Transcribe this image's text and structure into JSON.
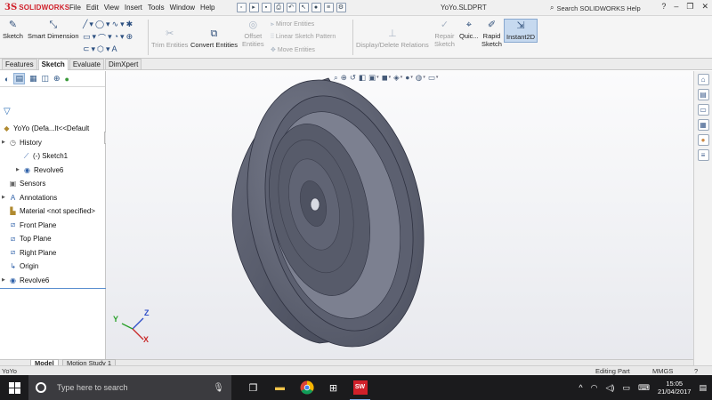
{
  "app": {
    "brand_prefix": "3S",
    "brand": "SOLIDWORKS",
    "menu": [
      "File",
      "Edit",
      "View",
      "Insert",
      "Tools",
      "Window",
      "Help"
    ],
    "document_title": "YoYo.SLDPRT",
    "search_placeholder": "Search SOLIDWORKS Help",
    "window_buttons": [
      "?",
      "–",
      "❐",
      "✕"
    ]
  },
  "command_manager": {
    "sketch": "Sketch",
    "smart_dimension": "Smart Dimension",
    "trim_entities_1": "Trim",
    "trim_entities_2": "Entities",
    "convert_entities_1": "Convert",
    "convert_entities_2": "Entities",
    "offset_entities_1": "Offset",
    "offset_entities_2": "Entities",
    "mirror_entities": "Mirror Entities",
    "linear_sketch_pattern": "Linear Sketch Pattern",
    "move_entities": "Move Entities",
    "display_delete_relations": "Display/Delete Relations",
    "repair_sketch_1": "Repair",
    "repair_sketch_2": "Sketch",
    "quick_snaps": "Quic...",
    "rapid_sketch_1": "Rapid",
    "rapid_sketch_2": "Sketch",
    "instant2d": "Instant2D"
  },
  "tabs": [
    "Features",
    "Sketch",
    "Evaluate",
    "DimXpert"
  ],
  "active_tab": "Sketch",
  "feature_tree": {
    "root": "YoYo  (Defa...lt<<Default",
    "history": "History",
    "sketch1": "(-) Sketch1",
    "revolve6_history": "Revolve6",
    "sensors": "Sensors",
    "annotations": "Annotations",
    "material": "Material <not specified>",
    "front_plane": "Front Plane",
    "top_plane": "Top Plane",
    "right_plane": "Right Plane",
    "origin": "Origin",
    "revolve6": "Revolve6"
  },
  "triad": {
    "x": "X",
    "y": "Y",
    "z": "Z"
  },
  "model_tabs": [
    "Model",
    "Motion Study 1"
  ],
  "status": {
    "left": "YoYo",
    "mode": "Editing Part",
    "units": "MMGS"
  },
  "taskbar": {
    "search_placeholder": "Type here to search",
    "time": "15:05",
    "date": "21/04/2017",
    "solidworks_label": "SW"
  },
  "colors": {
    "brand_red": "#d0202a",
    "model_body": "#5b5f6e",
    "model_rim": "#6c7080",
    "taskbar": "#1b1b1d"
  }
}
